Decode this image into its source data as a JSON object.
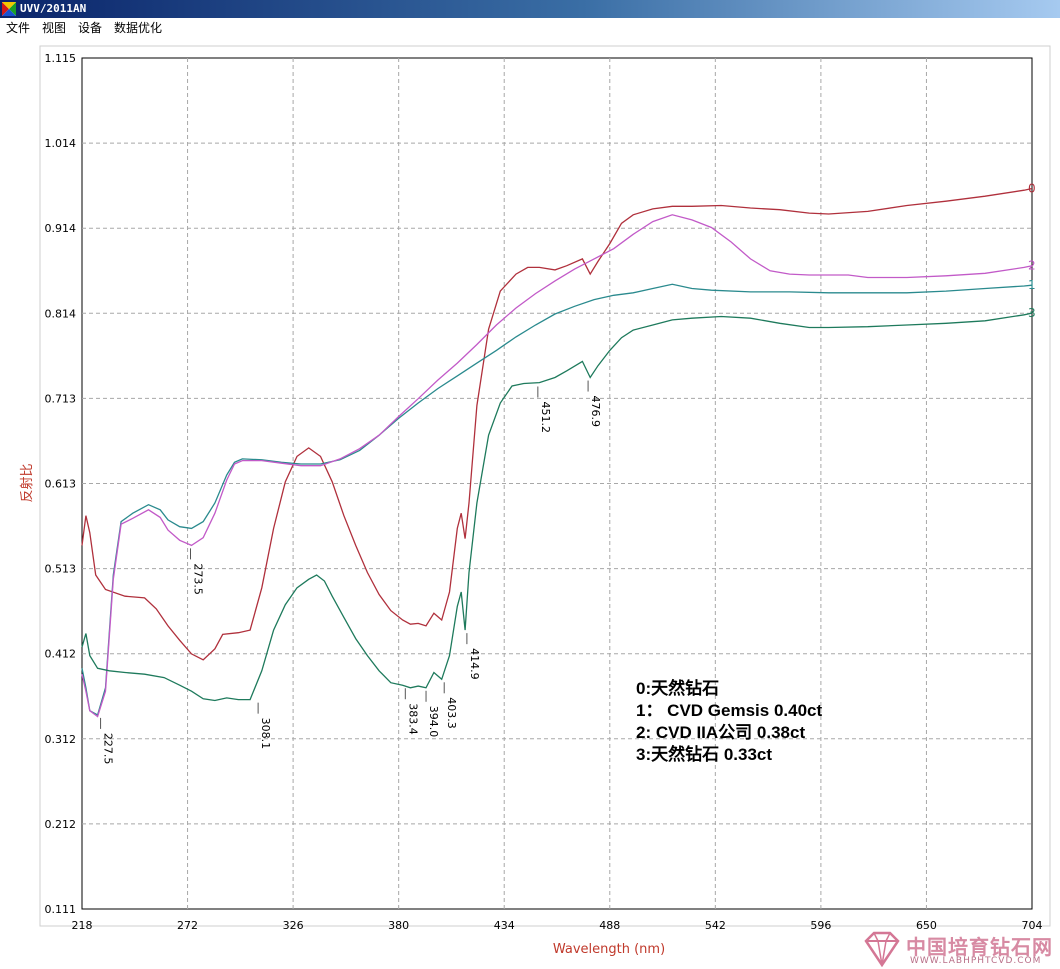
{
  "window": {
    "title": "UVV/2011AN",
    "menu": [
      "文件",
      "视图",
      "设备",
      "数据优化"
    ]
  },
  "legend": {
    "lines": [
      "0:天然钻石",
      "1：  CVD Gemsis 0.40ct",
      "2: CVD IIA公司 0.38ct",
      "3:天然钻石 0.33ct"
    ]
  },
  "watermark": {
    "text": "中国培育钻石网",
    "sub": "WWW.LABHPHTCVD.COM"
  },
  "chart_data": {
    "type": "line",
    "xlabel": "Wavelength (nm)",
    "ylabel": "反射比",
    "xlim": [
      218,
      704
    ],
    "ylim": [
      0.111,
      1.115
    ],
    "xticks": [
      "218",
      "272",
      "326",
      "380",
      "434",
      "488",
      "542",
      "596",
      "650",
      "704"
    ],
    "yticks": [
      "0.111",
      "0.212",
      "0.312",
      "0.412",
      "0.513",
      "0.613",
      "0.713",
      "0.814",
      "0.914",
      "1.014",
      "1.115"
    ],
    "grid": true,
    "series": [
      {
        "name": "0",
        "color": "#b0303c",
        "points": [
          [
            218,
            0.54
          ],
          [
            220,
            0.575
          ],
          [
            222,
            0.555
          ],
          [
            225,
            0.505
          ],
          [
            230,
            0.488
          ],
          [
            240,
            0.48
          ],
          [
            250,
            0.478
          ],
          [
            256,
            0.465
          ],
          [
            262,
            0.445
          ],
          [
            268,
            0.428
          ],
          [
            274,
            0.412
          ],
          [
            280,
            0.405
          ],
          [
            286,
            0.418
          ],
          [
            290,
            0.435
          ],
          [
            298,
            0.437
          ],
          [
            304,
            0.44
          ],
          [
            310,
            0.49
          ],
          [
            316,
            0.56
          ],
          [
            322,
            0.615
          ],
          [
            328,
            0.645
          ],
          [
            334,
            0.655
          ],
          [
            340,
            0.645
          ],
          [
            346,
            0.615
          ],
          [
            352,
            0.575
          ],
          [
            358,
            0.54
          ],
          [
            364,
            0.508
          ],
          [
            370,
            0.482
          ],
          [
            376,
            0.463
          ],
          [
            382,
            0.452
          ],
          [
            386,
            0.447
          ],
          [
            390,
            0.448
          ],
          [
            394,
            0.445
          ],
          [
            398,
            0.46
          ],
          [
            402,
            0.452
          ],
          [
            406,
            0.485
          ],
          [
            410,
            0.56
          ],
          [
            412,
            0.578
          ],
          [
            414,
            0.548
          ],
          [
            416,
            0.59
          ],
          [
            420,
            0.705
          ],
          [
            426,
            0.795
          ],
          [
            432,
            0.84
          ],
          [
            440,
            0.86
          ],
          [
            446,
            0.868
          ],
          [
            452,
            0.868
          ],
          [
            460,
            0.865
          ],
          [
            466,
            0.87
          ],
          [
            474,
            0.878
          ],
          [
            478,
            0.86
          ],
          [
            482,
            0.875
          ],
          [
            488,
            0.896
          ],
          [
            494,
            0.92
          ],
          [
            500,
            0.93
          ],
          [
            510,
            0.937
          ],
          [
            520,
            0.94
          ],
          [
            530,
            0.94
          ],
          [
            545,
            0.941
          ],
          [
            560,
            0.938
          ],
          [
            575,
            0.936
          ],
          [
            590,
            0.932
          ],
          [
            600,
            0.931
          ],
          [
            620,
            0.934
          ],
          [
            640,
            0.941
          ],
          [
            660,
            0.946
          ],
          [
            680,
            0.952
          ],
          [
            700,
            0.959
          ],
          [
            704,
            0.961
          ]
        ]
      },
      {
        "name": "1",
        "color": "#2a8a8e",
        "points": [
          [
            218,
            0.395
          ],
          [
            220,
            0.372
          ],
          [
            222,
            0.345
          ],
          [
            226,
            0.34
          ],
          [
            230,
            0.372
          ],
          [
            234,
            0.505
          ],
          [
            238,
            0.568
          ],
          [
            244,
            0.578
          ],
          [
            252,
            0.588
          ],
          [
            258,
            0.582
          ],
          [
            262,
            0.57
          ],
          [
            268,
            0.562
          ],
          [
            274,
            0.56
          ],
          [
            280,
            0.568
          ],
          [
            286,
            0.59
          ],
          [
            292,
            0.623
          ],
          [
            296,
            0.638
          ],
          [
            300,
            0.642
          ],
          [
            310,
            0.641
          ],
          [
            320,
            0.638
          ],
          [
            330,
            0.636
          ],
          [
            340,
            0.636
          ],
          [
            350,
            0.641
          ],
          [
            360,
            0.652
          ],
          [
            370,
            0.67
          ],
          [
            380,
            0.69
          ],
          [
            390,
            0.708
          ],
          [
            400,
            0.725
          ],
          [
            410,
            0.74
          ],
          [
            420,
            0.755
          ],
          [
            430,
            0.77
          ],
          [
            440,
            0.786
          ],
          [
            450,
            0.8
          ],
          [
            460,
            0.813
          ],
          [
            470,
            0.822
          ],
          [
            480,
            0.83
          ],
          [
            490,
            0.835
          ],
          [
            500,
            0.838
          ],
          [
            510,
            0.843
          ],
          [
            520,
            0.848
          ],
          [
            530,
            0.843
          ],
          [
            540,
            0.841
          ],
          [
            560,
            0.839
          ],
          [
            580,
            0.839
          ],
          [
            600,
            0.838
          ],
          [
            620,
            0.838
          ],
          [
            640,
            0.838
          ],
          [
            660,
            0.84
          ],
          [
            680,
            0.843
          ],
          [
            700,
            0.846
          ],
          [
            704,
            0.847
          ]
        ]
      },
      {
        "name": "2",
        "color": "#c25ac8",
        "points": [
          [
            218,
            0.388
          ],
          [
            220,
            0.368
          ],
          [
            222,
            0.345
          ],
          [
            226,
            0.338
          ],
          [
            230,
            0.368
          ],
          [
            234,
            0.5
          ],
          [
            238,
            0.565
          ],
          [
            244,
            0.572
          ],
          [
            252,
            0.582
          ],
          [
            258,
            0.573
          ],
          [
            262,
            0.558
          ],
          [
            268,
            0.546
          ],
          [
            274,
            0.54
          ],
          [
            280,
            0.549
          ],
          [
            286,
            0.578
          ],
          [
            292,
            0.617
          ],
          [
            296,
            0.636
          ],
          [
            300,
            0.64
          ],
          [
            310,
            0.64
          ],
          [
            320,
            0.637
          ],
          [
            330,
            0.634
          ],
          [
            340,
            0.634
          ],
          [
            350,
            0.642
          ],
          [
            360,
            0.654
          ],
          [
            370,
            0.67
          ],
          [
            380,
            0.692
          ],
          [
            390,
            0.713
          ],
          [
            400,
            0.735
          ],
          [
            410,
            0.755
          ],
          [
            420,
            0.777
          ],
          [
            430,
            0.8
          ],
          [
            440,
            0.82
          ],
          [
            450,
            0.837
          ],
          [
            460,
            0.852
          ],
          [
            470,
            0.866
          ],
          [
            480,
            0.878
          ],
          [
            490,
            0.89
          ],
          [
            500,
            0.907
          ],
          [
            510,
            0.922
          ],
          [
            520,
            0.93
          ],
          [
            530,
            0.924
          ],
          [
            540,
            0.915
          ],
          [
            550,
            0.898
          ],
          [
            560,
            0.878
          ],
          [
            570,
            0.864
          ],
          [
            580,
            0.86
          ],
          [
            590,
            0.859
          ],
          [
            600,
            0.859
          ],
          [
            610,
            0.859
          ],
          [
            620,
            0.856
          ],
          [
            640,
            0.856
          ],
          [
            660,
            0.858
          ],
          [
            680,
            0.861
          ],
          [
            700,
            0.868
          ],
          [
            704,
            0.87
          ]
        ]
      },
      {
        "name": "3",
        "color": "#1e7a5c",
        "points": [
          [
            218,
            0.42
          ],
          [
            220,
            0.436
          ],
          [
            222,
            0.41
          ],
          [
            226,
            0.395
          ],
          [
            232,
            0.392
          ],
          [
            240,
            0.39
          ],
          [
            250,
            0.388
          ],
          [
            260,
            0.384
          ],
          [
            268,
            0.375
          ],
          [
            274,
            0.368
          ],
          [
            280,
            0.359
          ],
          [
            286,
            0.357
          ],
          [
            292,
            0.36
          ],
          [
            298,
            0.358
          ],
          [
            304,
            0.358
          ],
          [
            310,
            0.392
          ],
          [
            316,
            0.44
          ],
          [
            322,
            0.47
          ],
          [
            328,
            0.49
          ],
          [
            334,
            0.5
          ],
          [
            338,
            0.505
          ],
          [
            342,
            0.498
          ],
          [
            346,
            0.48
          ],
          [
            352,
            0.455
          ],
          [
            358,
            0.43
          ],
          [
            364,
            0.41
          ],
          [
            370,
            0.392
          ],
          [
            376,
            0.378
          ],
          [
            382,
            0.375
          ],
          [
            386,
            0.372
          ],
          [
            390,
            0.374
          ],
          [
            394,
            0.372
          ],
          [
            398,
            0.39
          ],
          [
            402,
            0.382
          ],
          [
            406,
            0.41
          ],
          [
            410,
            0.468
          ],
          [
            412,
            0.485
          ],
          [
            414,
            0.44
          ],
          [
            416,
            0.508
          ],
          [
            420,
            0.59
          ],
          [
            426,
            0.67
          ],
          [
            432,
            0.708
          ],
          [
            438,
            0.728
          ],
          [
            444,
            0.731
          ],
          [
            452,
            0.732
          ],
          [
            460,
            0.738
          ],
          [
            466,
            0.746
          ],
          [
            474,
            0.757
          ],
          [
            478,
            0.738
          ],
          [
            482,
            0.752
          ],
          [
            488,
            0.77
          ],
          [
            494,
            0.785
          ],
          [
            500,
            0.794
          ],
          [
            510,
            0.8
          ],
          [
            520,
            0.806
          ],
          [
            530,
            0.808
          ],
          [
            545,
            0.81
          ],
          [
            560,
            0.808
          ],
          [
            575,
            0.802
          ],
          [
            590,
            0.797
          ],
          [
            600,
            0.797
          ],
          [
            620,
            0.798
          ],
          [
            640,
            0.8
          ],
          [
            660,
            0.802
          ],
          [
            680,
            0.805
          ],
          [
            700,
            0.812
          ],
          [
            704,
            0.814
          ]
        ]
      }
    ],
    "peak_labels": [
      {
        "x": 227.5,
        "y": 0.34,
        "text": "227.5"
      },
      {
        "x": 273.5,
        "y": 0.54,
        "text": "273.5"
      },
      {
        "x": 308.1,
        "y": 0.358,
        "text": "308.1"
      },
      {
        "x": 383.4,
        "y": 0.375,
        "text": "383.4"
      },
      {
        "x": 394.0,
        "y": 0.372,
        "text": "394.0"
      },
      {
        "x": 403.3,
        "y": 0.382,
        "text": "403.3"
      },
      {
        "x": 414.9,
        "y": 0.44,
        "text": "414.9"
      },
      {
        "x": 451.2,
        "y": 0.731,
        "text": "451.2"
      },
      {
        "x": 476.9,
        "y": 0.738,
        "text": "476.9"
      }
    ]
  }
}
